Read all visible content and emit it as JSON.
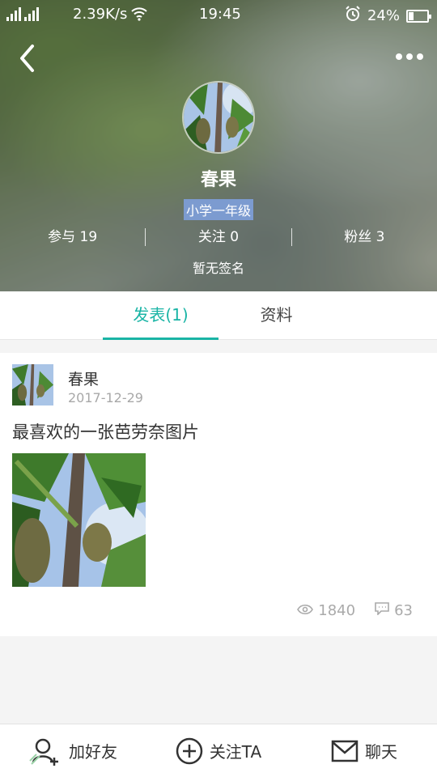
{
  "status_bar": {
    "net_speed": "2.39K/s",
    "time": "19:45",
    "battery_text": "24%",
    "battery_level": 0.24
  },
  "profile": {
    "name": "春果",
    "grade": "小学一年级",
    "stats": {
      "participate": "参与 19",
      "following": "关注 0",
      "followers": "粉丝 3"
    },
    "signature": "暂无签名"
  },
  "tabs": [
    {
      "label": "发表(1)",
      "active": true
    },
    {
      "label": "资料",
      "active": false
    }
  ],
  "post": {
    "author": "春果",
    "date": "2017-12-29",
    "text": "最喜欢的一张芭劳奈图片",
    "views": "1840",
    "comments": "63"
  },
  "bottom_bar": {
    "add_friend": "加好友",
    "follow": "关注TA",
    "chat": "聊天"
  },
  "colors": {
    "accent": "#19b4a5",
    "grade_bg": "#7c9bd0"
  }
}
